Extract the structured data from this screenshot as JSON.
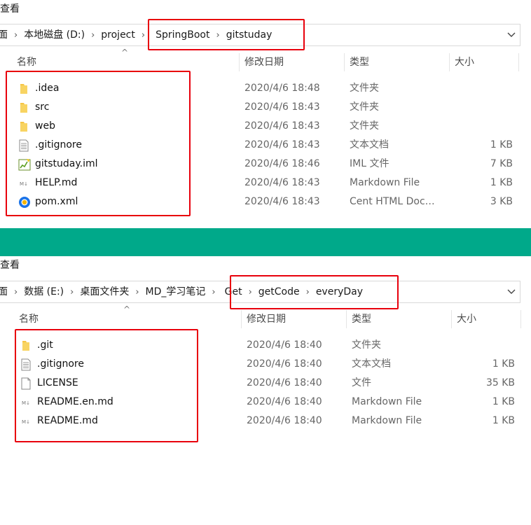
{
  "window1": {
    "ribbon_label": "查看",
    "address": {
      "root_tail": "面",
      "segments": [
        "本地磁盘 (D:)",
        "project",
        "SpringBoot",
        "gitstuday"
      ]
    },
    "columns": {
      "name": "名称",
      "modified": "修改日期",
      "type": "类型",
      "size": "大小"
    },
    "files": [
      {
        "icon": "folder-icon",
        "name": ".idea",
        "modified": "2020/4/6 18:48",
        "type": "文件夹",
        "size": ""
      },
      {
        "icon": "folder-icon",
        "name": "src",
        "modified": "2020/4/6 18:43",
        "type": "文件夹",
        "size": ""
      },
      {
        "icon": "folder-icon",
        "name": "web",
        "modified": "2020/4/6 18:43",
        "type": "文件夹",
        "size": ""
      },
      {
        "icon": "text-file-icon",
        "name": ".gitignore",
        "modified": "2020/4/6 18:43",
        "type": "文本文档",
        "size": "1 KB"
      },
      {
        "icon": "iml-file-icon",
        "name": "gitstuday.iml",
        "modified": "2020/4/6 18:46",
        "type": "IML 文件",
        "size": "7 KB"
      },
      {
        "icon": "markdown-file-icon",
        "name": "HELP.md",
        "modified": "2020/4/6 18:43",
        "type": "Markdown File",
        "size": "1 KB"
      },
      {
        "icon": "browser-file-icon",
        "name": "pom.xml",
        "modified": "2020/4/6 18:43",
        "type": "Cent HTML Doc…",
        "size": "3 KB"
      }
    ]
  },
  "window2": {
    "ribbon_label": "查看",
    "address": {
      "root_tail": "面",
      "segments": [
        "数据 (E:)",
        "桌面文件夹",
        "MD_学习笔记",
        "Get",
        "getCode",
        "everyDay"
      ]
    },
    "columns": {
      "name": "名称",
      "modified": "修改日期",
      "type": "类型",
      "size": "大小"
    },
    "files": [
      {
        "icon": "folder-icon",
        "name": ".git",
        "modified": "2020/4/6 18:40",
        "type": "文件夹",
        "size": ""
      },
      {
        "icon": "text-file-icon",
        "name": ".gitignore",
        "modified": "2020/4/6 18:40",
        "type": "文本文档",
        "size": "1 KB"
      },
      {
        "icon": "blank-file-icon",
        "name": "LICENSE",
        "modified": "2020/4/6 18:40",
        "type": "文件",
        "size": "35 KB"
      },
      {
        "icon": "markdown-file-icon",
        "name": "README.en.md",
        "modified": "2020/4/6 18:40",
        "type": "Markdown File",
        "size": "1 KB"
      },
      {
        "icon": "markdown-file-icon",
        "name": "README.md",
        "modified": "2020/4/6 18:40",
        "type": "Markdown File",
        "size": "1 KB"
      }
    ]
  },
  "colors": {
    "highlight": "#e8000c",
    "divider": "#00a98a",
    "folder": "#f5c445"
  }
}
